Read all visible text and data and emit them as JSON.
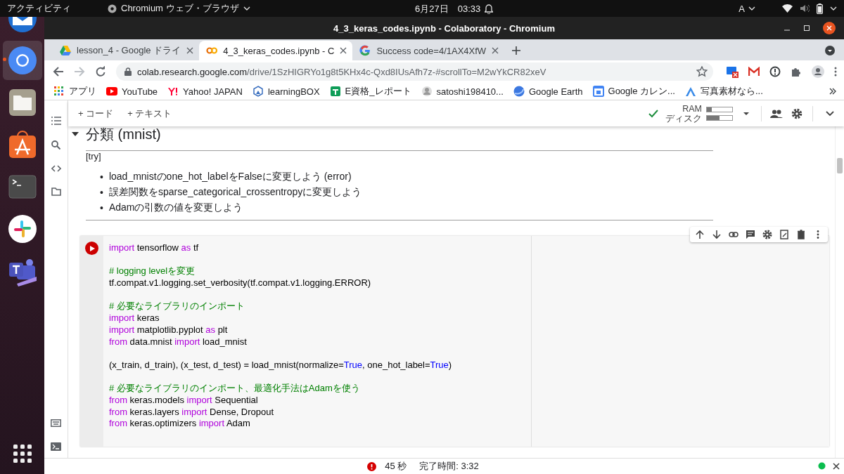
{
  "top_bar": {
    "activities": "アクティビティ",
    "app_menu": "Chromium ウェブ・ブラウザ",
    "clock": "6月27日　03:33",
    "input_method": "A"
  },
  "dock": {
    "apps": [
      {
        "kind": "mail",
        "running": false,
        "selected": false
      },
      {
        "kind": "browser",
        "running": true,
        "selected": true
      },
      {
        "kind": "files",
        "running": false,
        "selected": false
      },
      {
        "kind": "store",
        "running": false,
        "selected": false
      },
      {
        "kind": "terminal",
        "running": false,
        "selected": false
      },
      {
        "kind": "chat",
        "running": false,
        "selected": false
      },
      {
        "kind": "teams",
        "running": false,
        "selected": false
      }
    ]
  },
  "window": {
    "title": "4_3_keras_codes.ipynb - Colaboratory - Chromium"
  },
  "tabs": [
    {
      "label": "lesson_4 - Google ドライ",
      "kind": "drive",
      "selected": false
    },
    {
      "label": "4_3_keras_codes.ipynb - C",
      "kind": "colab",
      "selected": true
    },
    {
      "label": "Success code=4/1AX4XfW",
      "kind": "google",
      "selected": false
    }
  ],
  "address_bar": {
    "host": "colab.research.google.com",
    "path": "/drive/1SzHIGRYo1g8t5KHx4c-Qxd8IUsAfh7z-#scrollTo=M2wYkCR82xeV"
  },
  "bookmarks": [
    {
      "label": "アプリ",
      "kind": "apps"
    },
    {
      "label": "YouTube",
      "kind": "video"
    },
    {
      "label": "Yahoo! JAPAN",
      "kind": "yahoo"
    },
    {
      "label": "learningBOX",
      "kind": "hexagon"
    },
    {
      "label": "E資格_レポート",
      "kind": "sheet"
    },
    {
      "label": "satoshi198410...",
      "kind": "avatar"
    },
    {
      "label": "Google Earth",
      "kind": "globe"
    },
    {
      "label": "Google カレン...",
      "kind": "calendar"
    },
    {
      "label": "写真素材なら...",
      "kind": "photo"
    }
  ],
  "notebook": {
    "toolbar": {
      "add_code": "+ コード",
      "add_text": "+ テキスト",
      "connected": true,
      "ram_label": "RAM",
      "disk_label": "ディスク",
      "ram": {
        "level": 0.2
      },
      "disk": {
        "level": 0.5
      }
    },
    "section": {
      "title": "分類 (mnist)",
      "expanded": true,
      "subtitle": "[try]",
      "bullets": [
        {
          "marker": "•",
          "text": "load_mnistのone_hot_labelをFalseに変更しよう (error)"
        },
        {
          "marker": "•",
          "text": "誤差関数をsparse_categorical_crossentropyに変更しよう"
        },
        {
          "marker": "•",
          "text": "Adamの引数の値を変更しよう"
        }
      ]
    },
    "cell": {
      "code_blocks": [
        [
          [
            {
              "kind": "keyword",
              "text": "import"
            },
            {
              "kind": "plain",
              "text": " tensorflow "
            },
            {
              "kind": "keyword",
              "text": "as"
            },
            {
              "kind": "plain",
              "text": " tf"
            }
          ]
        ],
        [
          [
            {
              "kind": "comment",
              "text": "# logging levelを変更"
            }
          ],
          [
            {
              "kind": "plain",
              "text": "tf.compat.v1.logging.set_verbosity(tf.compat.v1.logging.ERROR)"
            }
          ]
        ],
        [
          [
            {
              "kind": "comment",
              "text": "# 必要なライブラリのインポート"
            }
          ],
          [
            {
              "kind": "keyword",
              "text": "import"
            },
            {
              "kind": "plain",
              "text": " keras"
            }
          ],
          [
            {
              "kind": "keyword",
              "text": "import"
            },
            {
              "kind": "plain",
              "text": " matplotlib.pyplot "
            },
            {
              "kind": "keyword",
              "text": "as"
            },
            {
              "kind": "plain",
              "text": " plt"
            }
          ],
          [
            {
              "kind": "keyword",
              "text": "from"
            },
            {
              "kind": "plain",
              "text": " data.mnist "
            },
            {
              "kind": "keyword",
              "text": "import"
            },
            {
              "kind": "plain",
              "text": " load_mnist"
            }
          ]
        ],
        [
          [
            {
              "kind": "plain",
              "text": "(x_train, d_train), (x_test, d_test) = load_mnist(normalize="
            },
            {
              "kind": "constant",
              "text": "True"
            },
            {
              "kind": "plain",
              "text": ", one_hot_label="
            },
            {
              "kind": "constant",
              "text": "True"
            },
            {
              "kind": "plain",
              "text": ")"
            }
          ]
        ],
        [
          [
            {
              "kind": "comment",
              "text": "# 必要なライブラリのインポート、最適化手法はAdamを使う"
            }
          ],
          [
            {
              "kind": "keyword",
              "text": "from"
            },
            {
              "kind": "plain",
              "text": " keras.models "
            },
            {
              "kind": "keyword",
              "text": "import"
            },
            {
              "kind": "plain",
              "text": " Sequential"
            }
          ],
          [
            {
              "kind": "keyword",
              "text": "from"
            },
            {
              "kind": "plain",
              "text": " keras.layers "
            },
            {
              "kind": "keyword",
              "text": "import"
            },
            {
              "kind": "plain",
              "text": " Dense, Dropout"
            }
          ],
          [
            {
              "kind": "keyword",
              "text": "from"
            },
            {
              "kind": "plain",
              "text": " keras.optimizers "
            },
            {
              "kind": "keyword",
              "text": "import"
            },
            {
              "kind": "plain",
              "text": " Adam"
            }
          ]
        ]
      ]
    }
  },
  "status_bar": {
    "error": true,
    "elapsed": "45 秒",
    "completed": "完了時間: 3:32"
  }
}
